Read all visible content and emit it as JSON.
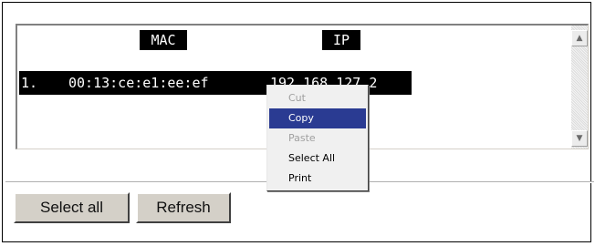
{
  "listbox": {
    "headers": {
      "mac": "MAC",
      "ip": "IP"
    },
    "rows": [
      {
        "index": "1.",
        "mac": "00:13:ce:e1:ee:ef",
        "ip": "192.168.127.2"
      }
    ],
    "scrollbar": {
      "up_icon": "scroll-up-arrow",
      "down_icon": "scroll-down-arrow"
    }
  },
  "buttons": {
    "select_all": "Select all",
    "refresh": "Refresh"
  },
  "context_menu": {
    "items": [
      {
        "label": "Cut",
        "state": "disabled"
      },
      {
        "label": "Copy",
        "state": "highlighted"
      },
      {
        "label": "Paste",
        "state": "disabled"
      },
      {
        "label": "Select All",
        "state": "enabled"
      },
      {
        "label": "Print",
        "state": "enabled"
      }
    ]
  },
  "colors": {
    "highlight": "#2a3b92",
    "selection_bg": "#000000",
    "button_face": "#d4d0c8"
  }
}
